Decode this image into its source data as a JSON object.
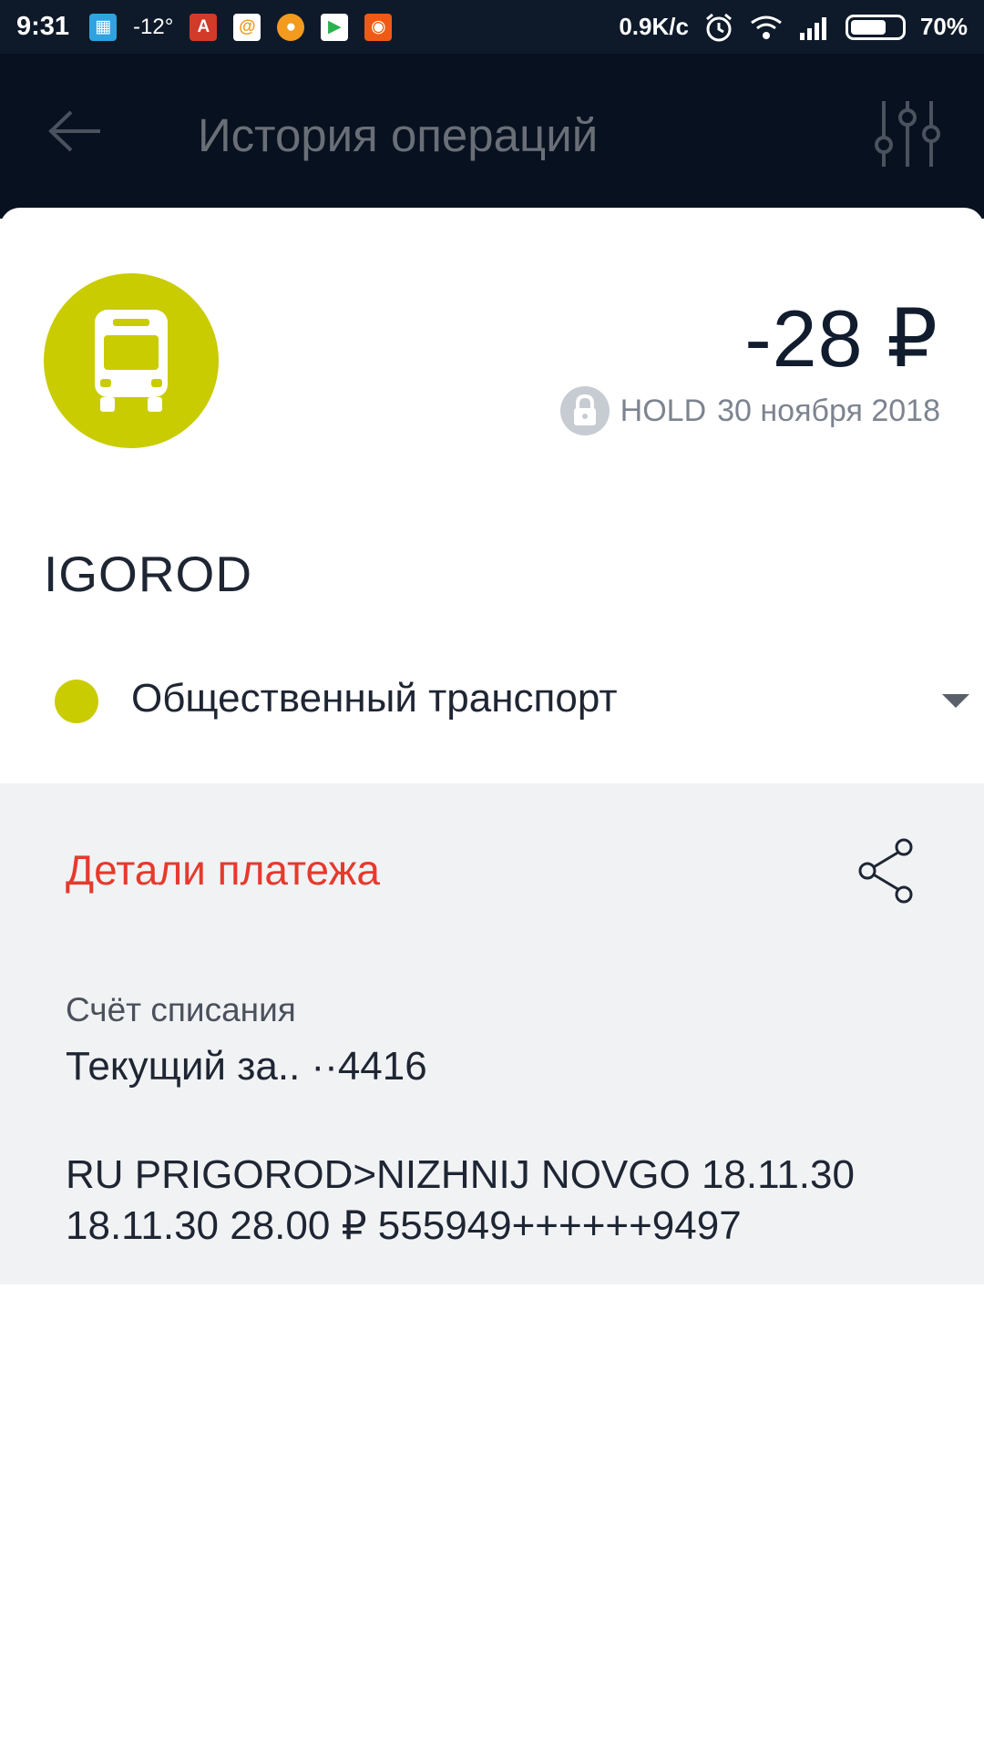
{
  "status_bar": {
    "time": "9:31",
    "temperature": "-12°",
    "net_speed": "0.9K/c",
    "battery_percent": "70%",
    "battery_level": 0.7
  },
  "app_bar": {
    "title": "История операций",
    "back_icon": "arrow-left-icon",
    "filter_icon": "sliders-icon"
  },
  "transaction": {
    "category_icon": "bus-icon",
    "category_color": "#c9cc00",
    "amount": "-28 ₽",
    "hold_label": "HOLD",
    "date": "30 ноября 2018",
    "merchant": "IGOROD",
    "category": "Общественный транспорт"
  },
  "details": {
    "title": "Детали платежа",
    "title_color": "#e53a2d",
    "account_label": "Счёт списания",
    "account_value": "Текущий за.. ··4416",
    "description_line1": "RU PRIGOROD>NIZHNIJ NOVGO 18.11.30",
    "description_line2": "18.11.30 28.00 ₽ 555949++++++9497"
  }
}
